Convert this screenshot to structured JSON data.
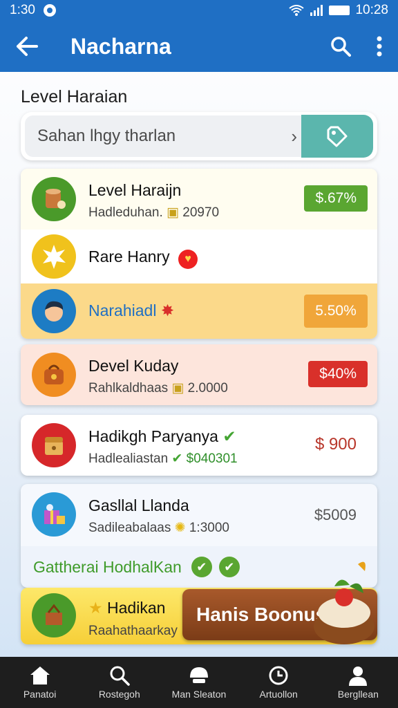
{
  "status": {
    "time_left": "1:30",
    "time_right": "10:28"
  },
  "appbar": {
    "title": "Nacharna"
  },
  "section_title": "Level Haraian",
  "search": {
    "text": "Sahan lhgy tharlan"
  },
  "items": [
    {
      "name": "Level Haraijn",
      "sub": "Hadleduhan.",
      "sub_value": "20970",
      "badge": "$.67%",
      "badge_color": "#5aa631",
      "avatar_color": "#4a9a2a",
      "icon": "cup-icon"
    },
    {
      "name": "Rare Hanry",
      "sub": "",
      "badge": "",
      "avatar_color": "#f0c21c",
      "icon": "burst-icon"
    },
    {
      "name": "Narahiadl",
      "sub": "",
      "badge": "5.50%",
      "badge_color": "#f0a63a",
      "avatar_color": "#1d7cc4",
      "icon": "person-icon"
    },
    {
      "name": "Devel Kuday",
      "sub": "Rahlkaldhaas",
      "sub_value": "2.0000",
      "badge": "$40%",
      "badge_color": "#d9302a",
      "avatar_color": "#f08d21",
      "icon": "bag-icon"
    },
    {
      "name": "Hadikgh Paryanya",
      "sub": "Hadlealiastan",
      "sub_value": "$040301",
      "badge": "$ 900",
      "badge_color": "#b8362a",
      "avatar_color": "#d6272a",
      "icon": "chest-icon"
    },
    {
      "name": "Gasllal Llanda",
      "sub": "Sadileabalaas",
      "sub_value": "1:3000",
      "badge": "$5009",
      "badge_color": "#555555",
      "avatar_color": "#2a9ad6",
      "icon": "gift-icon"
    }
  ],
  "green_banner": "Gattherai HodhalKan",
  "promo": {
    "name": "Hadikan",
    "sub": "Raahathaarkay",
    "bonus": "Hanis Boonus"
  },
  "nav": [
    {
      "label": "Panatoi",
      "icon": "home-icon"
    },
    {
      "label": "Rostegoh",
      "icon": "search-icon"
    },
    {
      "label": "Man Sleaton",
      "icon": "helmet-icon"
    },
    {
      "label": "Artuollon",
      "icon": "clock-icon"
    },
    {
      "label": "Bergllean",
      "icon": "user-icon"
    }
  ],
  "colors": {
    "primary": "#1f6fc4",
    "nav_bg": "#1e1e1e",
    "accent_green": "#5aa631"
  }
}
